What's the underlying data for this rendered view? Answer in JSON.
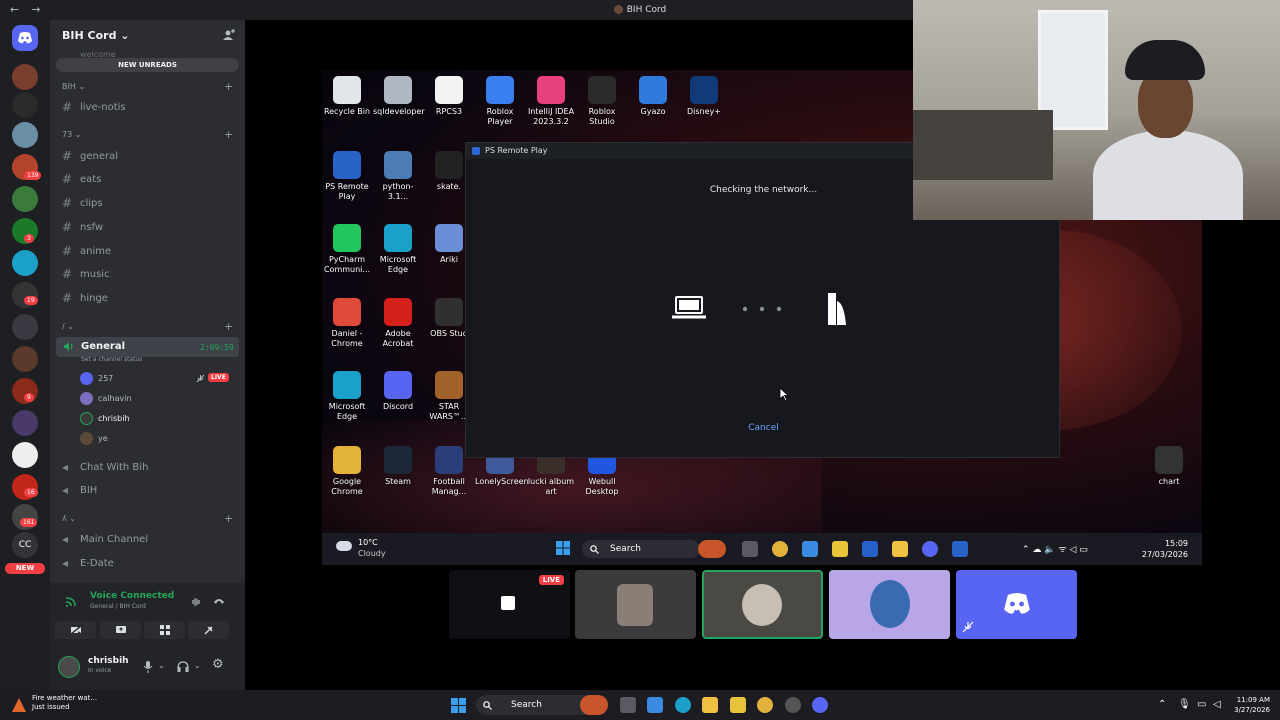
{
  "window": {
    "title": "BIH Cord"
  },
  "servers": {
    "badges": [
      "139",
      "3",
      "19",
      "9",
      "16",
      "161"
    ],
    "labels": [
      "CC",
      "NEW"
    ]
  },
  "sidebar": {
    "server_name": "BIH Cord",
    "truncated_top": "welcome",
    "new_unreads": "NEW UNREADS",
    "categories": [
      {
        "label": "BIH"
      },
      {
        "label": "73"
      },
      {
        "label": "/"
      },
      {
        "label": "ʎ"
      }
    ],
    "channels_bih": [
      "live-notis"
    ],
    "channels_73": [
      "general",
      "eats",
      "clips",
      "nsfw",
      "anime",
      "music",
      "hinge"
    ],
    "voice": {
      "name": "General",
      "timer": "2:09:59",
      "status": "Set a channel status",
      "members": [
        "257",
        "calhavin",
        "chrisbih",
        "ye"
      ],
      "live": "LIVE"
    },
    "voice_channels": [
      "Chat With Bih",
      "BIH"
    ],
    "channels_last": [
      "Main Channel",
      "E-Date"
    ]
  },
  "voice_panel": {
    "status": "Voice Connected",
    "where": "General / BIH Cord"
  },
  "user": {
    "name": "chrisbih",
    "status": "In voice"
  },
  "desktop": {
    "icons": [
      {
        "label": "Recycle Bin",
        "color": "#e0e6ea"
      },
      {
        "label": "sqldeveloper",
        "color": "#b0b8c4"
      },
      {
        "label": "RPCS3",
        "color": "#f2f2f2"
      },
      {
        "label": "Roblox Player",
        "color": "#3a7ff0"
      },
      {
        "label": "IntelliJ IDEA 2023.3.2",
        "color": "#e8407e"
      },
      {
        "label": "Roblox Studio",
        "color": "#2b2b2b"
      },
      {
        "label": "Gyazo",
        "color": "#2f7bdc"
      },
      {
        "label": "Disney+",
        "color": "#103a7a"
      },
      {
        "label": "PS Remote Play",
        "color": "#2a63c7"
      },
      {
        "label": "python-3.1...",
        "color": "#4b7cb4"
      },
      {
        "label": "skate.",
        "color": "#222"
      },
      {
        "label": "PyCharm Communi...",
        "color": "#22c55e"
      },
      {
        "label": "Microsoft Edge",
        "color": "#1aa0c9"
      },
      {
        "label": "Ariki",
        "color": "#6b8fd6"
      },
      {
        "label": "Daniel - Chrome",
        "color": "#e04a3a"
      },
      {
        "label": "Adobe Acrobat",
        "color": "#d4201b"
      },
      {
        "label": "OBS Stud",
        "color": "#303030"
      },
      {
        "label": "Microsoft Edge",
        "color": "#1aa0c9"
      },
      {
        "label": "Discord",
        "color": "#5865f2"
      },
      {
        "label": "STAR WARS™...",
        "color": "#a0622a"
      },
      {
        "label": "Google Chrome",
        "color": "#e2b23a"
      },
      {
        "label": "Steam",
        "color": "#1b2838"
      },
      {
        "label": "Football Manag...",
        "color": "#2a3f7a"
      },
      {
        "label": "LonelyScreen",
        "color": "#3e5a9a"
      },
      {
        "label": "lucki album art",
        "color": "#3a2e2a"
      },
      {
        "label": "Webull Desktop",
        "color": "#2057e0"
      },
      {
        "label": "chart",
        "color": "#333"
      }
    ],
    "taskbar": {
      "temp": "10°C",
      "weather": "Cloudy",
      "search": "Search",
      "time": "15:09",
      "date": "27/03/2026"
    }
  },
  "ps_remote": {
    "title": "PS Remote Play",
    "message": "Checking the network...",
    "cancel": "Cancel"
  },
  "tiles": {
    "live": "LIVE"
  },
  "os_taskbar": {
    "alert_title": "Fire weather wat...",
    "alert_sub": "Just issued",
    "search": "Search",
    "time": "11:09 AM",
    "date": "3/27/2026"
  },
  "colors": {
    "discord_blurple": "#5865f2",
    "voice_green": "#23a55a",
    "live_red": "#f23f43",
    "link_blue": "#6ea7ff"
  }
}
